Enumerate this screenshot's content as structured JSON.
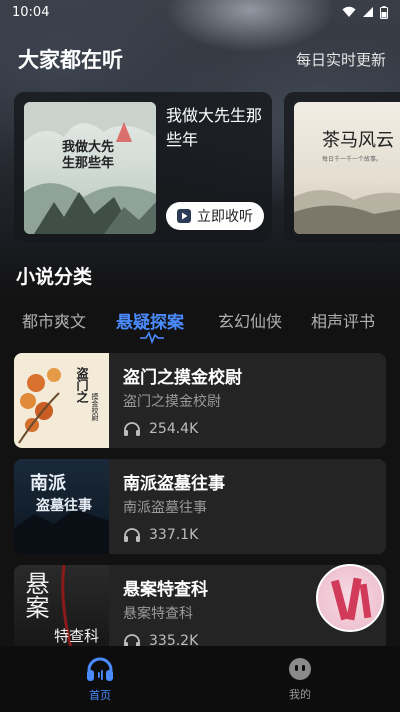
{
  "status_bar": {
    "time": "10:04"
  },
  "featured": {
    "title": "大家都在听",
    "subtitle": "每日实时更新",
    "cards": [
      {
        "name": "我做大先生那些年",
        "cover_text": "我做大先生那些年",
        "button": "立即收听"
      },
      {
        "name": "茶马风云",
        "cover_text": "茶马风云",
        "cover_small": "每日千一千一个故事。"
      }
    ]
  },
  "categories": {
    "title": "小说分类",
    "tabs": [
      "都市爽文",
      "悬疑探案",
      "玄幻仙侠",
      "相声评书"
    ],
    "active_tab": 1
  },
  "list": [
    {
      "title": "盗门之摸金校尉",
      "desc": "盗门之摸金校尉",
      "plays": "254.4K",
      "cover_text": "盗门之",
      "cover_text2": "摸金校尉"
    },
    {
      "title": "南派盗墓往事",
      "desc": "南派盗墓往事",
      "plays": "337.1K",
      "cover_text": "南派",
      "cover_text2": "盗墓往事"
    },
    {
      "title": "悬案特查科",
      "desc": "悬案特查科",
      "plays": "335.2K",
      "cover_text": "悬案",
      "cover_text2": "特查科"
    }
  ],
  "bottom_nav": [
    {
      "label": "首页",
      "icon": "headphones-icon",
      "active": true
    },
    {
      "label": "我的",
      "icon": "face-icon",
      "active": false
    }
  ],
  "colors": {
    "accent": "#4a8cff",
    "card_bg": "#242424",
    "nav_bg": "#0d0d0d"
  }
}
